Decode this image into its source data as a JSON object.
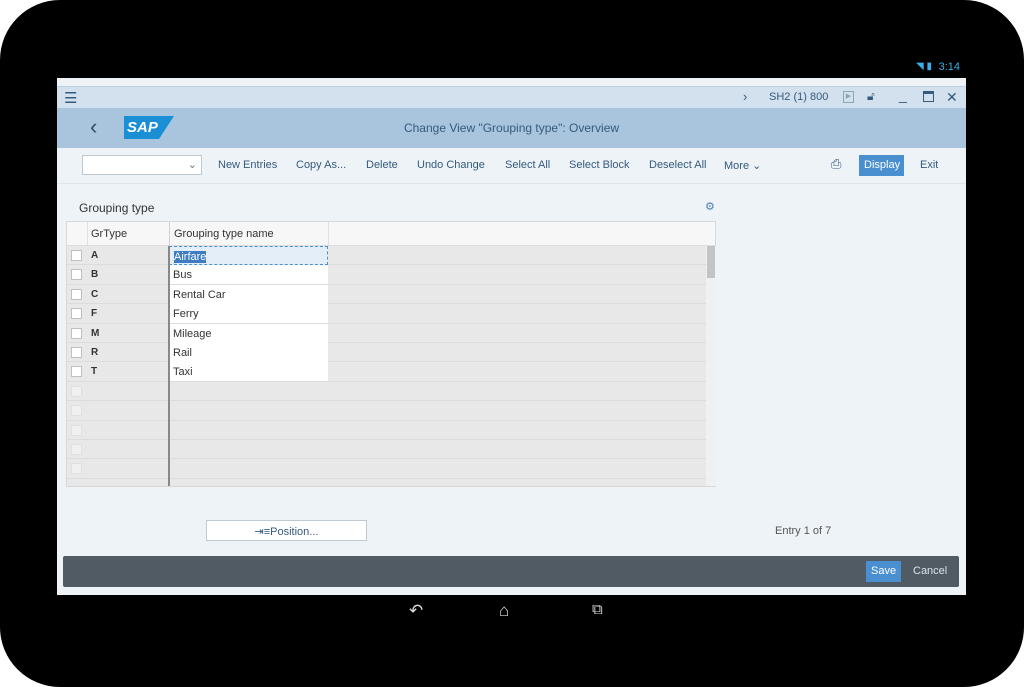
{
  "status_bar": {
    "time": "3:14",
    "icons": [
      "wifi-icon",
      "battery-icon"
    ]
  },
  "title_bar": {
    "system": "SH2 (1) 800"
  },
  "header": {
    "title": "Change View \"Grouping type\": Overview",
    "logo": "SAP"
  },
  "toolbar": {
    "dropdown_value": "",
    "items": [
      "New Entries",
      "Copy As...",
      "Delete",
      "Undo Change",
      "Select All",
      "Select Block",
      "Deselect All",
      "More"
    ],
    "display": "Display",
    "exit": "Exit"
  },
  "section": {
    "title": "Grouping type"
  },
  "table": {
    "columns": [
      "GrType",
      "Grouping type name"
    ],
    "rows": [
      {
        "key": "A",
        "name": "Airfare"
      },
      {
        "key": "B",
        "name": "Bus"
      },
      {
        "key": "C",
        "name": "Rental Car"
      },
      {
        "key": "F",
        "name": "Ferry"
      },
      {
        "key": "M",
        "name": "Mileage"
      },
      {
        "key": "R",
        "name": "Rail"
      },
      {
        "key": "T",
        "name": "Taxi"
      }
    ]
  },
  "position_button": "Position...",
  "entry_info": "Entry 1 of 7",
  "footer": {
    "save": "Save",
    "cancel": "Cancel"
  },
  "colors": {
    "accent": "#4a8fd0",
    "header": "#a9c5de",
    "footer": "#505b64"
  }
}
